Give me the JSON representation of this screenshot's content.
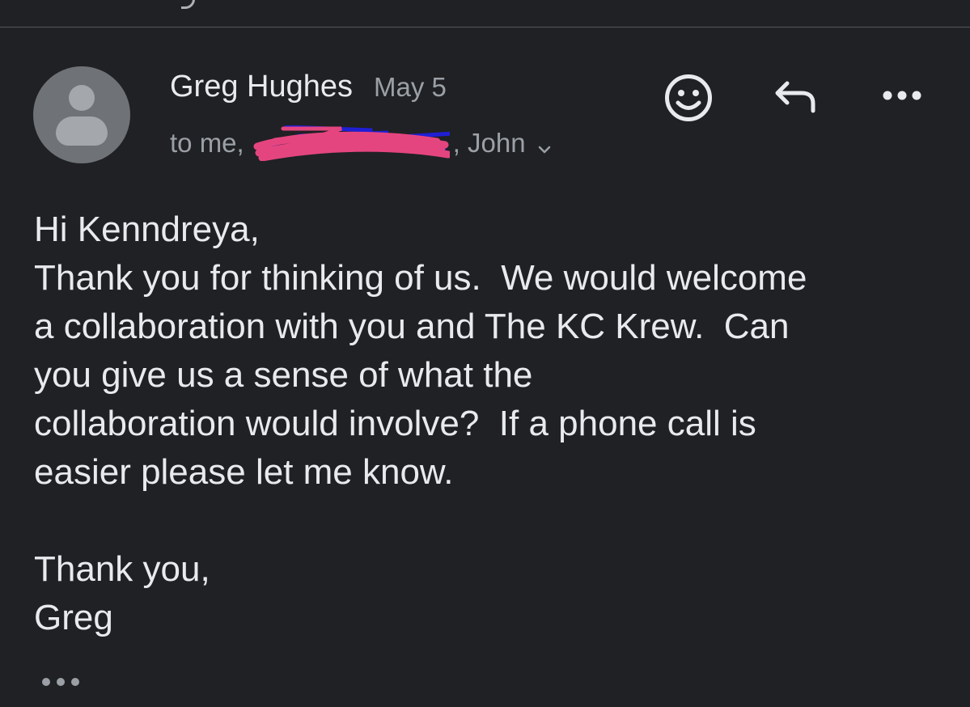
{
  "header": {
    "sender_name": "Greg Hughes",
    "date": "May 5",
    "recipients_prefix": "to me,",
    "recipients_visible_tail": ", John",
    "recipients_hidden_note": "redacted"
  },
  "actions": {
    "emoji_icon": "smiley-face-icon",
    "reply_icon": "reply-arrow-icon",
    "more_icon": "horizontal-ellipsis-icon"
  },
  "message": {
    "greeting": "Hi Kenndreya,",
    "paragraph": "Thank you for thinking of us.  We would welcome\na collaboration with you and The KC Krew.  Can\nyou give us a sense of what the\ncollaboration would involve?  If a phone call is\neasier please let me know.",
    "closing": "Thank you,",
    "signature": "Greg"
  },
  "footer": {
    "show_quoted_icon": "ellipsis-icon"
  },
  "colors": {
    "background": "#202124",
    "primary_text": "#e8eaed",
    "secondary_text": "#9aa0a6",
    "redaction_pink": "#e5457f",
    "redaction_blue": "#1f1fd6"
  }
}
